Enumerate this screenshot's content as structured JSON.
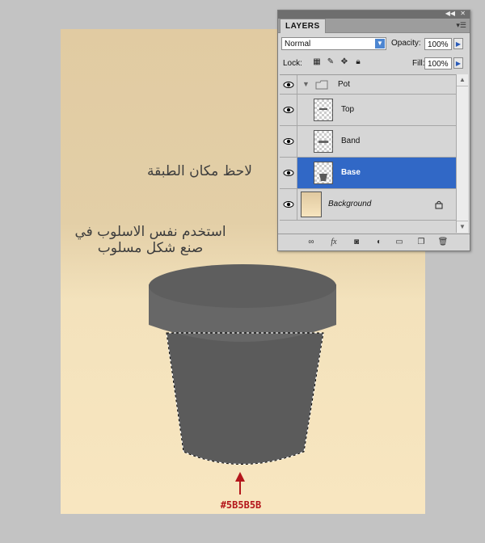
{
  "canvas": {
    "annotation_top": "لاحظ مكان الطبقة",
    "annotation_middle_line1": "استخدم نفس الاسلوب في",
    "annotation_middle_line2": "صنع شكل مسلوب",
    "color_label": "#5B5B5B",
    "pot_color": "#5B5B5B",
    "pot_top_color": "#616161",
    "pot_band_color": "#6a6a6a"
  },
  "layers_panel": {
    "tab": "LAYERS",
    "blend_mode": "Normal",
    "opacity_label": "Opacity:",
    "opacity_value": "100%",
    "lock_label": "Lock:",
    "fill_label": "Fill:",
    "fill_value": "100%",
    "selected_color": "#3168c6",
    "layers": [
      {
        "name": "Pot",
        "type": "group",
        "visible": true
      },
      {
        "name": "Top",
        "type": "layer",
        "visible": true
      },
      {
        "name": "Band",
        "type": "layer",
        "visible": true
      },
      {
        "name": "Base",
        "type": "layer",
        "visible": true,
        "selected": true
      },
      {
        "name": "Background",
        "type": "background",
        "visible": true,
        "locked": true
      }
    ],
    "footer_icons": [
      "link-icon",
      "fx-icon",
      "mask-icon",
      "adjustment-icon",
      "group-folder-icon",
      "new-layer-icon",
      "trash-icon"
    ]
  }
}
